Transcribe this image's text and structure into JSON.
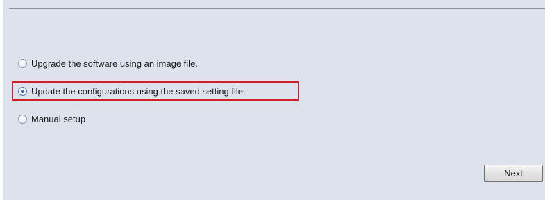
{
  "options": [
    {
      "label": "Upgrade the software using an image file.",
      "checked": false
    },
    {
      "label": "Update the configurations using the saved setting file.",
      "checked": true
    },
    {
      "label": "Manual setup",
      "checked": false
    }
  ],
  "buttons": {
    "next_label": "Next"
  },
  "colors": {
    "panel_background": "#dde2ec",
    "highlight_border": "#d0202a"
  }
}
